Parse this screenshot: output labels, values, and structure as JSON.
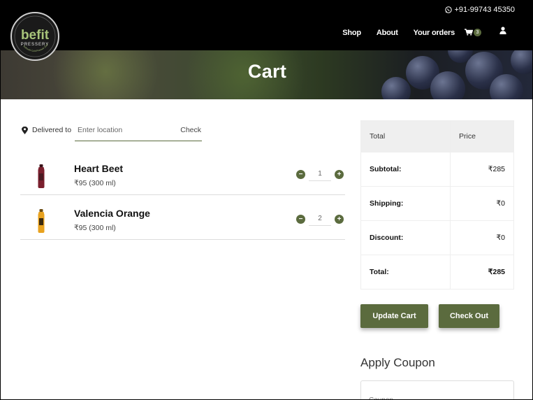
{
  "header": {
    "phone": "+91-99743 45350",
    "logo": {
      "brand": "befit",
      "sub": "PRESSERY",
      "tagline": "Authentic Cold Pressed Juice"
    },
    "nav": {
      "shop": "Shop",
      "about": "About",
      "orders": "Your orders",
      "cart_count": "3"
    }
  },
  "hero": {
    "title": "Cart"
  },
  "location": {
    "label": "Delivered to",
    "placeholder": "Enter location",
    "check": "Check"
  },
  "items": [
    {
      "name": "Heart Beet",
      "price": "₹95 (300 ml)",
      "qty": "1",
      "color": "#7a1f2d"
    },
    {
      "name": "Valencia Orange",
      "price": "₹95 (300 ml)",
      "qty": "2",
      "color": "#e8a21f"
    }
  ],
  "summary": {
    "col_total": "Total",
    "col_price": "Price",
    "rows": [
      {
        "label": "Subtotal:",
        "value": "₹285"
      },
      {
        "label": "Shipping:",
        "value": "₹0"
      },
      {
        "label": "Discount:",
        "value": "₹0"
      },
      {
        "label": "Total:",
        "value": "₹285"
      }
    ]
  },
  "buttons": {
    "update": "Update Cart",
    "checkout": "Check Out"
  },
  "coupon": {
    "title": "Apply Coupon",
    "placeholder": "Coupon"
  },
  "colors": {
    "accent": "#5b6b3e",
    "header_bg": "#000000"
  }
}
